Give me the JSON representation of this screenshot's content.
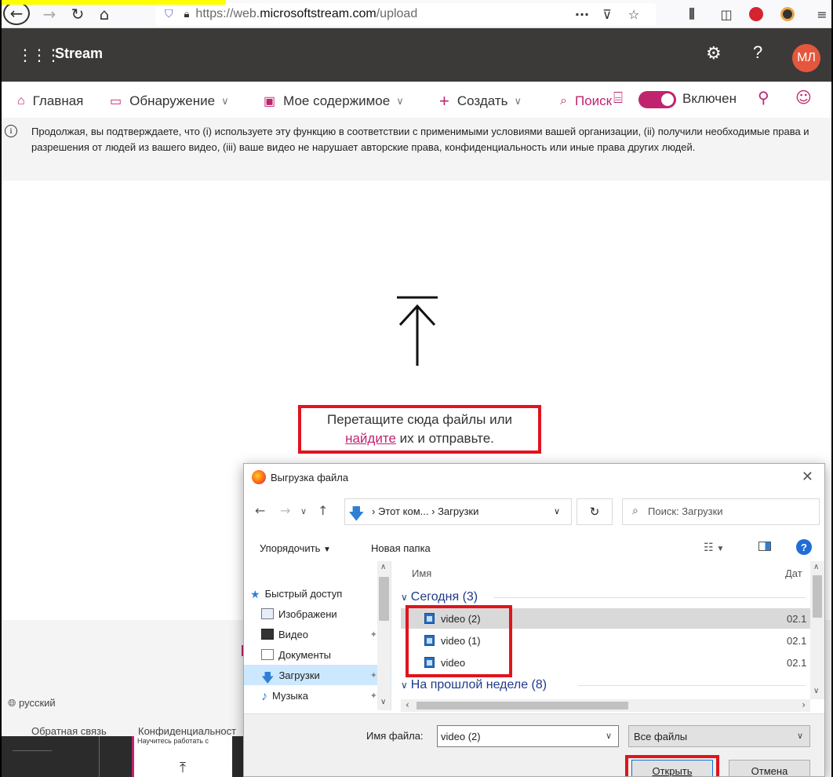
{
  "browser": {
    "url_prefix": "https://web.",
    "url_domain": "microsoftstream.com",
    "url_path": "/upload",
    "more": "···"
  },
  "app": {
    "name": "Stream",
    "avatar_initials": "МЛ",
    "help": "?"
  },
  "nav": {
    "home": "Главная",
    "discover": "Обнаружение",
    "my_content": "Мое содержимое",
    "create": "Создать",
    "search": "Поиск",
    "toggle_label": "Включен"
  },
  "notice": {
    "text": "Продолжая, вы подтверждаете, что (i) используете эту функцию в соответствии с применимыми условиями вашей организации, (ii) получили необходимые права и разрешения от людей из вашего видео, (iii) ваше видео не нарушает авторские права, конфиденциальность или иные права других людей."
  },
  "upload": {
    "line1": "Перетащите сюда файлы или",
    "link": "найдите",
    "line2_rest": " их и отправьте."
  },
  "footer": {
    "language": "русский",
    "feedback": "Обратная связь",
    "privacy": "Конфиденциальност",
    "thumb_text": "Научитесь работать с"
  },
  "dialog": {
    "title": "Выгрузка файла",
    "close": "✕",
    "address": {
      "part1": "Этот ком...",
      "sep": "›",
      "part2": "Загрузки"
    },
    "search_placeholder": "Поиск: Загрузки",
    "toolbar": {
      "organize": "Упорядочить",
      "new_folder": "Новая папка",
      "help": "?"
    },
    "nav_items": [
      {
        "label": "Быстрый доступ"
      },
      {
        "label": "Изображени"
      },
      {
        "label": "Видео"
      },
      {
        "label": "Документы"
      },
      {
        "label": "Загрузки"
      },
      {
        "label": "Музыка"
      }
    ],
    "columns": {
      "name": "Имя",
      "date": "Дат"
    },
    "groups": [
      {
        "label": "Сегодня (3)"
      },
      {
        "label": "На прошлой неделе (8)"
      }
    ],
    "files": [
      {
        "name": "video (2)",
        "date": "02.1"
      },
      {
        "name": "video (1)",
        "date": "02.1"
      },
      {
        "name": "video",
        "date": "02.1"
      }
    ],
    "filename_label": "Имя файла:",
    "filename_value": "video (2)",
    "filetype": "Все файлы",
    "open_button": "Открыть",
    "cancel_button": "Отмена"
  },
  "colors": {
    "accent": "#c0246f",
    "header_bg": "#3b3a39",
    "avatar_bg": "#e4573d",
    "highlight_red": "#e0141e"
  }
}
